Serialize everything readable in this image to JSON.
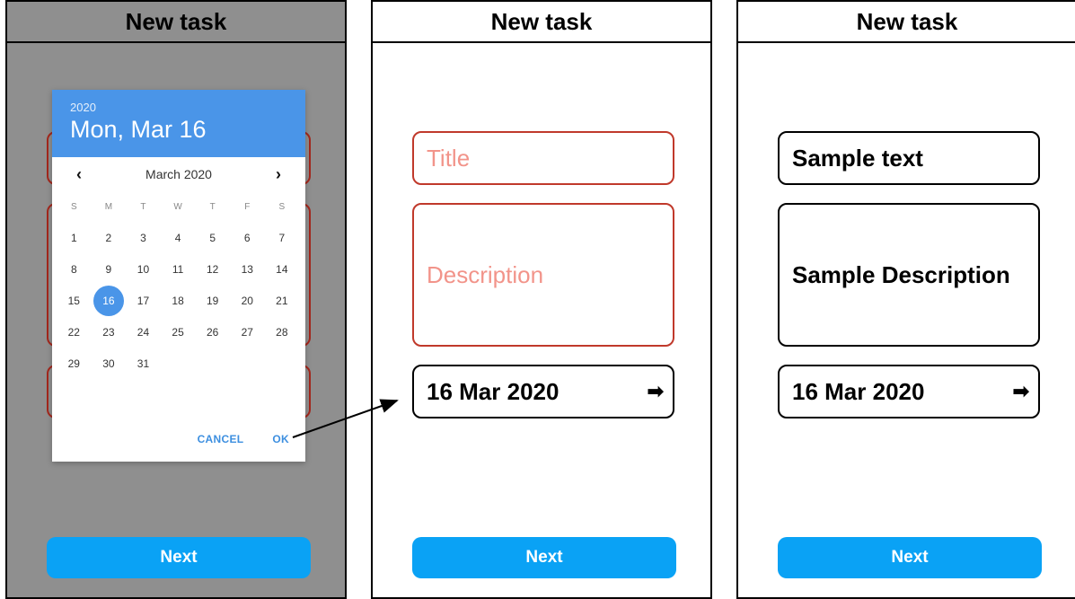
{
  "screens": [
    {
      "title": "New task",
      "date_picker": {
        "year": "2020",
        "selected_display": "Mon, Mar 16",
        "month_label": "March 2020",
        "prev_icon": "chevron-left-icon",
        "next_icon": "chevron-right-icon",
        "weekdays": [
          "S",
          "M",
          "T",
          "W",
          "T",
          "F",
          "S"
        ],
        "start_offset": 0,
        "days": [
          "1",
          "2",
          "3",
          "4",
          "5",
          "6",
          "7",
          "8",
          "9",
          "10",
          "11",
          "12",
          "13",
          "14",
          "15",
          "16",
          "17",
          "18",
          "19",
          "20",
          "21",
          "22",
          "23",
          "24",
          "25",
          "26",
          "27",
          "28",
          "29",
          "30",
          "31"
        ],
        "selected_day": "16",
        "cancel_label": "CANCEL",
        "ok_label": "OK"
      },
      "next_label": "Next"
    },
    {
      "title": "New task",
      "title_placeholder": "Title",
      "description_placeholder": "Description",
      "date_value": "16 Mar 2020",
      "date_arrow": "➡",
      "next_label": "Next"
    },
    {
      "title": "New task",
      "title_value": "Sample text",
      "description_value": "Sample Description",
      "date_value": "16 Mar 2020",
      "date_arrow": "➡",
      "next_label": "Next"
    }
  ],
  "colors": {
    "accent": "#0aa2f5",
    "picker_header": "#4a95e8",
    "error_border": "#c0392b",
    "placeholder_text": "#f2948a",
    "overlay": "#8f8f8f"
  }
}
